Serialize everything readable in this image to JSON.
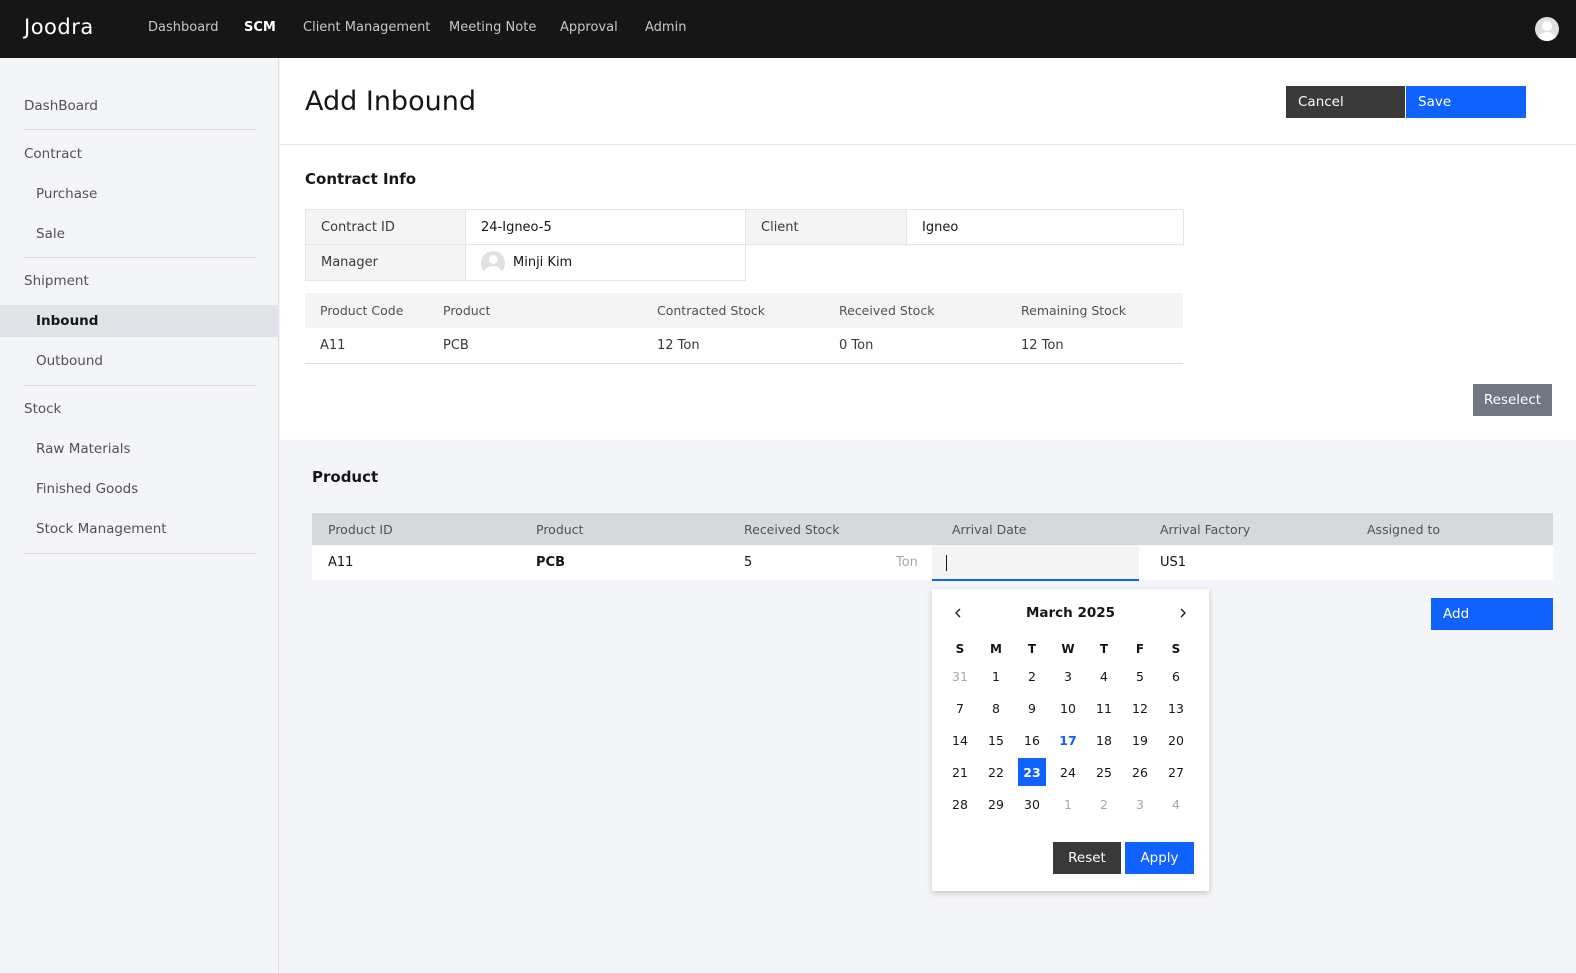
{
  "app": {
    "logo": "Joodra"
  },
  "topnav": {
    "items": [
      {
        "label": "Dashboard"
      },
      {
        "label": "SCM",
        "active": true
      },
      {
        "label": "Client Management"
      },
      {
        "label": "Meeting Note"
      },
      {
        "label": "Approval"
      },
      {
        "label": "Admin"
      }
    ]
  },
  "sidebar": {
    "dashboard": "DashBoard",
    "contract": {
      "label": "Contract",
      "items": [
        "Purchase",
        "Sale"
      ]
    },
    "shipment": {
      "label": "Shipment",
      "items": [
        "Inbound",
        "Outbound"
      ],
      "active": "Inbound"
    },
    "stock": {
      "label": "Stock",
      "items": [
        "Raw Materials",
        "Finished Goods",
        "Stock Management"
      ]
    }
  },
  "page": {
    "title": "Add Inbound",
    "cancel_label": "Cancel",
    "save_label": "Save"
  },
  "contract_info": {
    "title": "Contract Info",
    "contract_id_label": "Contract ID",
    "contract_id": "24-Igneo-5",
    "client_label": "Client",
    "client": "Igneo",
    "manager_label": "Manager",
    "manager": "Minji Kim",
    "columns": [
      "Product Code",
      "Product",
      "Contracted Stock",
      "Received Stock",
      "Remaining Stock"
    ],
    "rows": [
      [
        "A11",
        "PCB",
        "12 Ton",
        "0 Ton",
        "12 Ton"
      ]
    ],
    "reselect_label": "Reselect"
  },
  "product": {
    "title": "Product",
    "columns": [
      "Product ID",
      "Product",
      "Received Stock",
      "Arrival Date",
      "Arrival Factory",
      "Assigned to"
    ],
    "row": {
      "product_id": "A11",
      "product": "PCB",
      "received_stock": "5",
      "unit": "Ton",
      "arrival_date": "",
      "arrival_factory": "US1",
      "assigned_to": ""
    },
    "add_label": "Add"
  },
  "calendar": {
    "month_label": "March 2025",
    "weekdays": [
      "S",
      "M",
      "T",
      "W",
      "T",
      "F",
      "S"
    ],
    "weeks": [
      [
        "31",
        "1",
        "2",
        "3",
        "4",
        "5",
        "6"
      ],
      [
        "7",
        "8",
        "9",
        "10",
        "11",
        "12",
        "13"
      ],
      [
        "14",
        "15",
        "16",
        "17",
        "18",
        "19",
        "20"
      ],
      [
        "21",
        "22",
        "23",
        "24",
        "25",
        "26",
        "27"
      ],
      [
        "28",
        "29",
        "30",
        "1",
        "2",
        "3",
        "4"
      ]
    ],
    "today": "17",
    "selected": "23",
    "reset_label": "Reset",
    "apply_label": "Apply",
    "accent_color": "#0f62fe"
  }
}
